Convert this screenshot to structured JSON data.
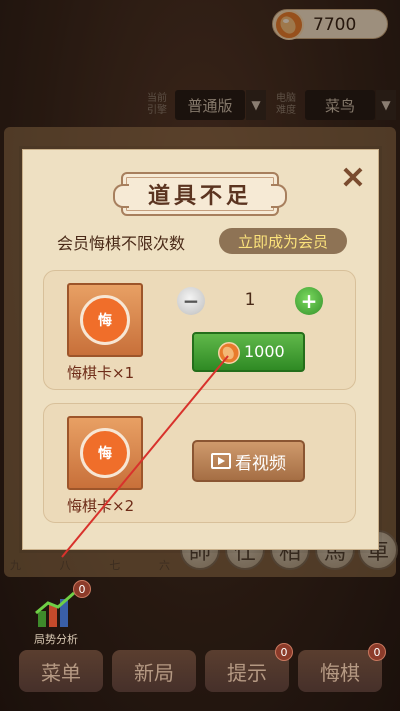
{
  "header": {
    "coin_balance": "7700",
    "icon": "peanut-coin-icon"
  },
  "settings": {
    "engine_label": "当前\n引擎",
    "engine_value": "普通版",
    "difficulty_label": "电脑\n难度",
    "difficulty_value": "菜鸟"
  },
  "board": {
    "file_numbers": [
      "九",
      "八",
      "七",
      "六"
    ],
    "pieces": [
      "帥",
      "仕",
      "相",
      "馬",
      "車"
    ]
  },
  "dialog": {
    "title": "道具不足",
    "close_icon": "close-icon",
    "vip_text": "会员悔棋不限次数",
    "vip_button": "立即成为会员",
    "items": [
      {
        "icon_text": "悔",
        "label": "悔棋卡×1",
        "quantity": "1",
        "price": "1000"
      },
      {
        "icon_text": "悔",
        "label": "悔棋卡×2",
        "video_button": "看视频"
      }
    ]
  },
  "bottom": {
    "analysis_label": "局势分析",
    "analysis_badge": "0",
    "menu_buttons": [
      {
        "label": "菜单",
        "badge": ""
      },
      {
        "label": "新局",
        "badge": ""
      },
      {
        "label": "提示",
        "badge": "0"
      },
      {
        "label": "悔棋",
        "badge": "0"
      }
    ]
  },
  "colors": {
    "accent_green": "#3f9a30",
    "vip_gold": "#fbe27b",
    "overlay_line": "#d8322c"
  }
}
